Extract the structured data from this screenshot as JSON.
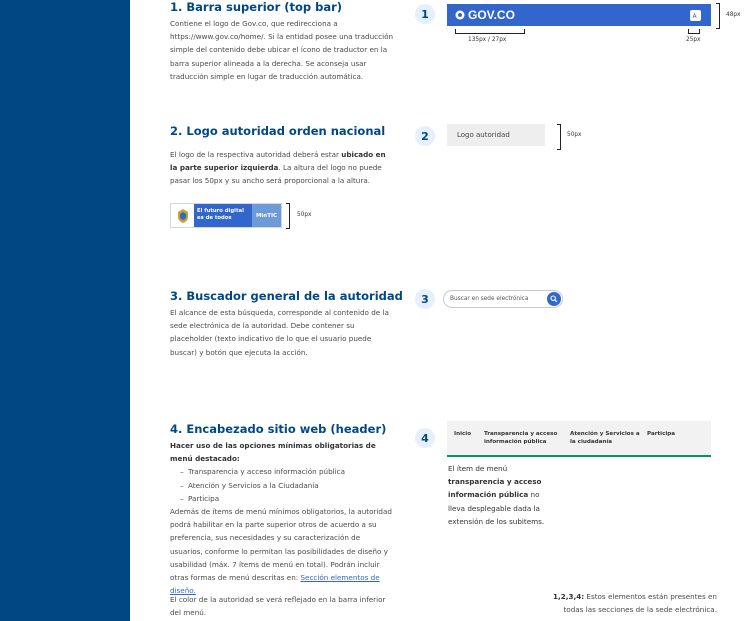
{
  "sections": [
    {
      "number": "1",
      "title": "1. Barra superior (top bar)",
      "body": "Contiene el logo de Gov.co, que redirecciona a https://www.gov.co/home/. Si la entidad posee una traducción simple del contenido debe ubicar el ícono de traductor en la barra superior alineada a la derecha. Se aconseja usar traducción simple en lugar de traducción automática.",
      "topbar": {
        "logo_text": "GOV.CO",
        "height_label": "48px",
        "logo_width_label": "135px / 27px",
        "icon_width_label": "25px"
      }
    },
    {
      "number": "2",
      "title": "2. Logo autoridad orden nacional",
      "body_pre": "El logo de la respectiva autoridad deberá estar ",
      "body_bold": "ubicado en la parte superior izquierda",
      "body_post": ". La altura del logo no puede pasar los 50px y su ancho será proporcional a la altura.",
      "placeholder_label": "Logo autoridad",
      "height_label": "50px",
      "example_logo": {
        "line1": "El futuro digital",
        "line2": "es de todos",
        "ministry": "MinTIC",
        "height_label": "50px"
      }
    },
    {
      "number": "3",
      "title": "3. Buscador general de la autoridad",
      "body": "El alcance de esta búsqueda, corresponde al contenido de la sede electrónica de la autoridad. Debe contener su placeholder (texto indicativo de lo que el usuario puede buscar) y botón que ejecuta la acción.",
      "search_placeholder": "Buscar en sede electrónica"
    },
    {
      "number": "4",
      "title": "4. Encabezado sitio web (header)",
      "intro_bold": "Hacer uso de las opciones mínimas obligatorias de menú destacado:",
      "items": [
        "Transparencia y acceso información pública",
        "Atención y Servicios a la Ciudadanía",
        "Participa"
      ],
      "body_pre": "Además de ítems de menú mínimos obligatorios, la autoridad podrá habilitar en la parte superior otros de acuerdo a su preferencia, sus necesidades y su caracterización de usuarios, conforme lo permitan las posibilidades de diseño y usabilidad (máx. 7 ítems de menú en total). Podrán incluir otras formas de menú descritas en: ",
      "body_link": "Sección elementos de diseño.",
      "footer_text": "El color de la autoridad se verá reflejado en la barra inferior del menú.",
      "menu": {
        "items": [
          "Inicio",
          "Transparencia y acceso información pública",
          "Atención y Servicios a la ciudadanía",
          "Participa"
        ],
        "accent_color": "#069169"
      },
      "note_pre": "El ítem de menú ",
      "note_bold": "transparencia y acceso información pública",
      "note_post": " no lleva desplegable dada la extensión de  los subitems."
    }
  ],
  "footnote": {
    "bold": "1,2,3,4:",
    "text": " Estos elementos están presentes en todas las secciones de la sede electrónica."
  },
  "colors": {
    "sidebar": "#004884",
    "brand": "#3366cc",
    "accent": "#069169"
  }
}
